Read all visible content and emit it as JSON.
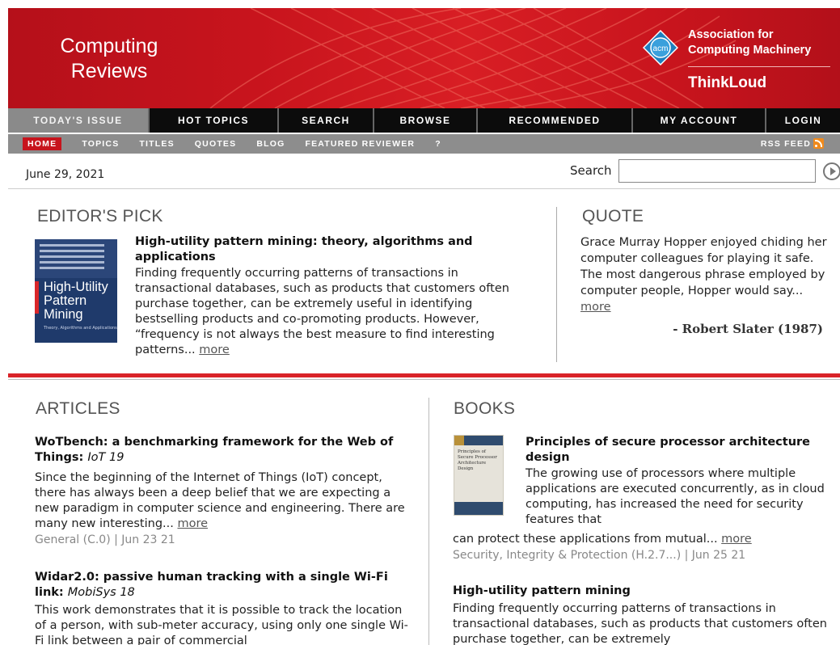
{
  "header": {
    "logo_line1": "Computing",
    "logo_line2": "Reviews",
    "acm_badge": "acm",
    "org_line1": "Association for",
    "org_line2": "Computing Machinery",
    "tagline": "ThinkLoud"
  },
  "main_nav": [
    "TODAY'S ISSUE",
    "HOT TOPICS",
    "SEARCH",
    "BROWSE",
    "RECOMMENDED",
    "MY ACCOUNT",
    "LOGIN"
  ],
  "sub_nav": [
    "HOME",
    "TOPICS",
    "TITLES",
    "QUOTES",
    "BLOG",
    "FEATURED REVIEWER",
    "?"
  ],
  "rss_label": "RSS FEED",
  "date": "June 29, 2021",
  "search": {
    "label": "Search",
    "value": ""
  },
  "editors_pick": {
    "heading": "EDITOR'S PICK",
    "cover_title": "High-Utility Pattern Mining",
    "cover_subtitle": "Theory, Algorithms and Applications",
    "title": "High-utility pattern mining: theory, algorithms and applications",
    "text": "Finding frequently occurring patterns of transactions in transactional databases, such as products that customers often purchase together, can be extremely useful in identifying bestselling products and co-promoting products. However, “frequency is not always the best measure to find interesting patterns... ",
    "more": "more"
  },
  "quote": {
    "heading": "QUOTE",
    "text": "Grace Murray Hopper enjoyed chiding her computer colleagues for playing it safe. The most dangerous phrase employed by computer people, Hopper would say... ",
    "more": "more",
    "author": "- Robert Slater (1987)"
  },
  "articles": {
    "heading": "ARTICLES",
    "items": [
      {
        "title": "WoTbench: a benchmarking framework for the Web of Things",
        "venue": "IoT 19",
        "text": "Since the beginning of the Internet of Things (IoT) concept, there has always been a deep belief that we are expecting a new paradigm in computer science and engineering. There are many new interesting... ",
        "more": "more",
        "meta": "General (C.0) | Jun 23 21"
      },
      {
        "title": "Widar2.0: passive human tracking with a single Wi-Fi link",
        "venue": "MobiSys 18",
        "text": "This work demonstrates that it is possible to track the location of a person, with sub-meter accuracy, using only one single Wi-Fi link between a pair of commercial"
      }
    ]
  },
  "books": {
    "heading": "BOOKS",
    "items": [
      {
        "cover_title": "Principles of Secure Processor Architecture Design",
        "title": "Principles of secure processor architecture design",
        "text_wrap": "The growing use of processors where multiple applications are executed concurrently, as in cloud computing, has increased the need for security features that",
        "text_rest": "can protect these applications from mutual... ",
        "more": "more",
        "meta": "Security, Integrity & Protection (H.2.7...) | Jun 25 21"
      },
      {
        "title": "High-utility pattern mining",
        "text": "Finding frequently occurring patterns of transactions in transactional databases, such as products that customers often purchase together, can be extremely"
      }
    ]
  },
  "colors": {
    "brand_red": "#c8141d",
    "nav_black": "#0c0c0c",
    "subnav_grey": "#8d8d8d",
    "rss_orange": "#f08a1c"
  }
}
